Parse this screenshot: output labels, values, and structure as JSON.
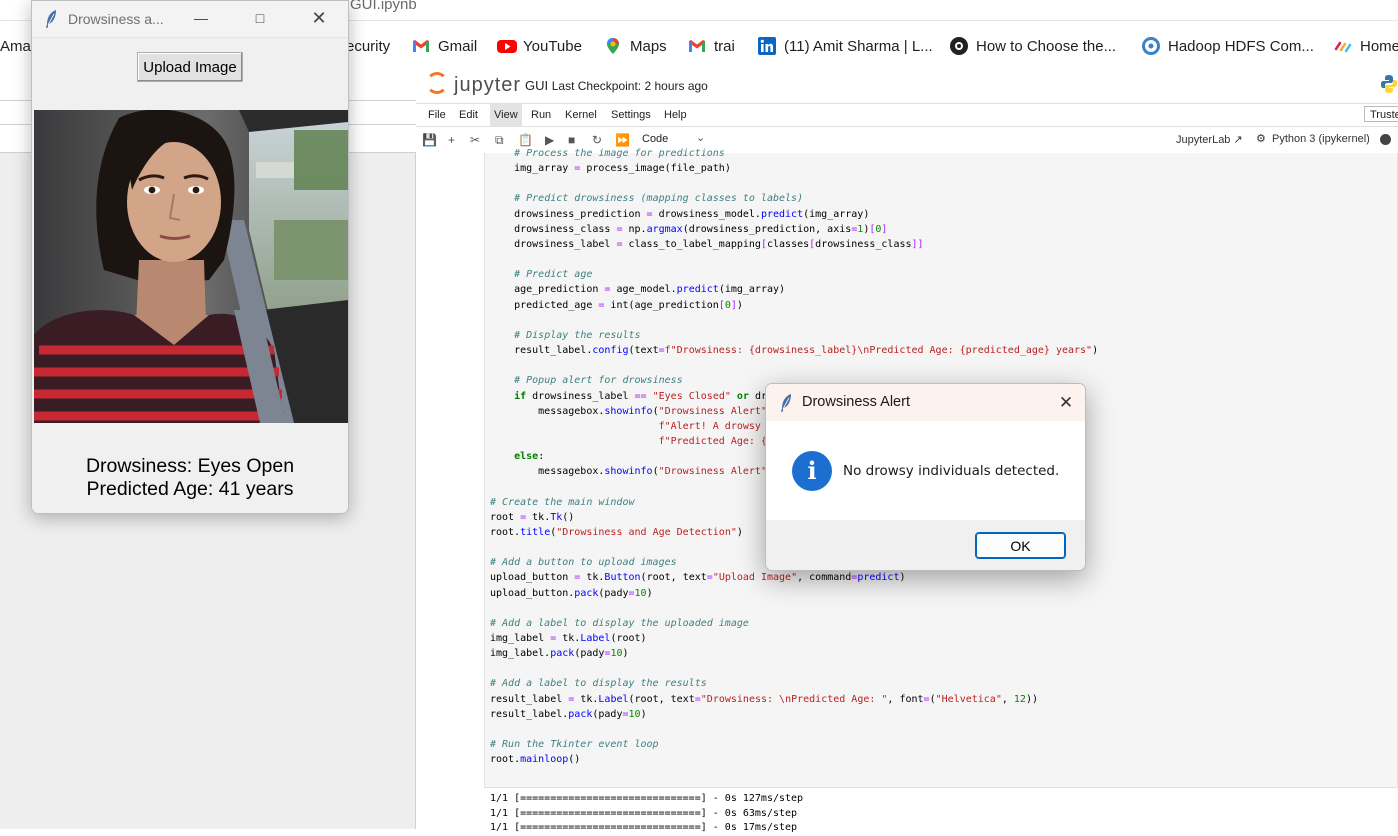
{
  "browser": {
    "tab_title": "GUI.ipynb",
    "bookmarks": [
      {
        "label": "Amaz",
        "icon": "amazon-icon"
      },
      {
        "label": "ecurity",
        "icon": "none"
      },
      {
        "label": "Gmail",
        "icon": "gmail-icon"
      },
      {
        "label": "YouTube",
        "icon": "youtube-icon"
      },
      {
        "label": "Maps",
        "icon": "maps-icon"
      },
      {
        "label": "trai",
        "icon": "gmail-icon"
      },
      {
        "label": "(11) Amit Sharma | L...",
        "icon": "linkedin-icon"
      },
      {
        "label": "How to Choose the...",
        "icon": "medium-icon"
      },
      {
        "label": "Hadoop HDFS Com...",
        "icon": "hadoop-icon"
      },
      {
        "label": "Home",
        "icon": "slack-icon"
      }
    ]
  },
  "jupyter": {
    "logo_text": "jupyter",
    "notebook_name": "GUI",
    "checkpoint": "Last Checkpoint: 2 hours ago",
    "menu": [
      "File",
      "Edit",
      "View",
      "Run",
      "Kernel",
      "Settings",
      "Help"
    ],
    "trusted": "Trusted",
    "cell_type": "Code",
    "jupyterlab_link": "JupyterLab",
    "kernel": "Python 3 (ipykernel)"
  },
  "code_lines": [
    "    # Process the image for predictions",
    "    img_array = process_image(file_path)",
    "",
    "    # Predict drowsiness (mapping classes to labels)",
    "    drowsiness_prediction = drowsiness_model.predict(img_array)",
    "    drowsiness_class = np.argmax(drowsiness_prediction, axis=1)[0]",
    "    drowsiness_label = class_to_label_mapping[classes[drowsiness_class]]",
    "",
    "    # Predict age",
    "    age_prediction = age_model.predict(img_array)",
    "    predicted_age = int(age_prediction[0])",
    "",
    "    # Display the results",
    "    result_label.config(text=f\"Drowsiness: {drowsiness_label}\\nPredicted Age: {predicted_age} years\")",
    "",
    "    # Popup alert for drowsiness",
    "    if drowsiness_label == \"Eyes Closed\" or dr",
    "        messagebox.showinfo(\"Drowsiness Alert\"",
    "                            f\"Alert! A drowsy",
    "                            f\"Predicted Age: {",
    "    else:",
    "        messagebox.showinfo(\"Drowsiness Alert\"",
    "",
    "# Create the main window",
    "root = tk.Tk()",
    "root.title(\"Drowsiness and Age Detection\")",
    "",
    "# Add a button to upload images",
    "upload_button = tk.Button(root, text=\"Upload Image\", command=predict)",
    "upload_button.pack(pady=10)",
    "",
    "# Add a label to display the uploaded image",
    "img_label = tk.Label(root)",
    "img_label.pack(pady=10)",
    "",
    "# Add a label to display the results",
    "result_label = tk.Label(root, text=\"Drowsiness: \\nPredicted Age: \", font=(\"Helvetica\", 12))",
    "result_label.pack(pady=10)",
    "",
    "# Run the Tkinter event loop",
    "root.mainloop()"
  ],
  "output_lines": [
    "1/1 [==============================] - 0s 127ms/step",
    "1/1 [==============================] - 0s 63ms/step",
    "1/1 [==============================] - 0s 17ms/step"
  ],
  "tk_window": {
    "title": "Drowsiness a...",
    "upload_button": "Upload Image",
    "result_line1": "Drowsiness: Eyes Open",
    "result_line2": "Predicted Age: 41 years"
  },
  "dialog": {
    "title": "Drowsiness Alert",
    "message": "No drowsy individuals detected.",
    "ok_label": "OK"
  },
  "colors": {
    "dialog_accent": "#0067c0",
    "info_icon": "#1c6fd0",
    "jupyter_orange": "#f37726"
  }
}
